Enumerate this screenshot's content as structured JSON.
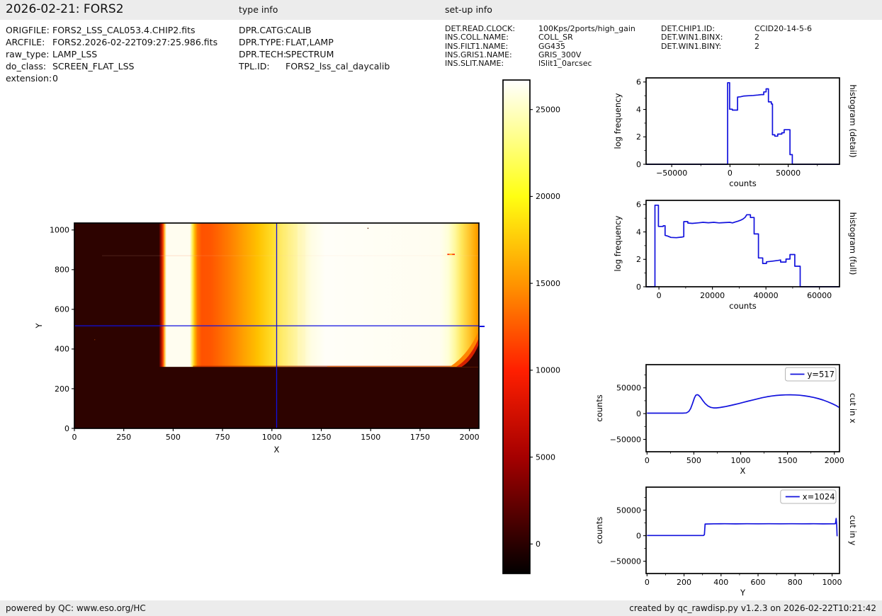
{
  "header": {
    "title": "2026-02-21: FORS2",
    "type_info_label": "type info",
    "setup_info_label": "set-up info"
  },
  "file_info": {
    "rows": [
      {
        "label": "ORIGFILE:",
        "value": "FORS2_LSS_CAL053.4.CHIP2.fits"
      },
      {
        "label": "ARCFILE:",
        "value": "FORS2.2026-02-22T09:27:25.986.fits"
      },
      {
        "label": "raw_type:",
        "value": "LAMP_LSS"
      },
      {
        "label": "do_class:",
        "value": "SCREEN_FLAT_LSS"
      },
      {
        "label": "extension:",
        "value": "0"
      }
    ]
  },
  "type_info": {
    "rows": [
      {
        "label": "DPR.CATG:",
        "value": "CALIB"
      },
      {
        "label": "DPR.TYPE:",
        "value": "FLAT,LAMP"
      },
      {
        "label": "DPR.TECH:",
        "value": "SPECTRUM"
      },
      {
        "label": "TPL.ID:",
        "value": "FORS2_lss_cal_daycalib"
      }
    ]
  },
  "setup_info": {
    "col1": [
      {
        "label": "DET.READ.CLOCK:",
        "value": "100Kps/2ports/high_gain"
      },
      {
        "label": "INS.COLL.NAME:",
        "value": "COLL_SR"
      },
      {
        "label": "INS.FILT1.NAME:",
        "value": "GG435"
      },
      {
        "label": "INS.GRIS1.NAME:",
        "value": "GRIS_300V"
      },
      {
        "label": "INS.SLIT.NAME:",
        "value": "lSlit1_0arcsec"
      }
    ],
    "col2": [
      {
        "label": "DET.CHIP1.ID:",
        "value": "CCID20-14-5-6"
      },
      {
        "label": "DET.WIN1.BINX:",
        "value": "2"
      },
      {
        "label": "DET.WIN1.BINY:",
        "value": "2"
      }
    ]
  },
  "footer": {
    "left": "powered by QC: www.eso.org/HC",
    "right": "created by qc_rawdisp.py v1.2.3 on 2026-02-22T10:21:42"
  },
  "colors": {
    "accent_blue": "#0f0fe0",
    "bar_gray": "#ececec",
    "heatmap_dark": "#2d0300"
  },
  "chart_data": [
    {
      "id": "main-image",
      "type": "heatmap",
      "xlabel": "X",
      "ylabel": "Y",
      "xlim": [
        0,
        2048
      ],
      "ylim": [
        0,
        1035
      ],
      "xticks": [
        0,
        250,
        500,
        750,
        1000,
        1250,
        1500,
        1750,
        2000
      ],
      "yticks": [
        0,
        200,
        400,
        600,
        800,
        1000
      ],
      "colormap": "hot",
      "background_color": "#2d0300",
      "crosshair": {
        "x": 1024,
        "y": 517,
        "color": "#0f0fe0"
      },
      "illuminated_region": {
        "x_range": [
          430,
          2048
        ],
        "y_range": [
          310,
          1035
        ]
      },
      "gradient_stops": [
        [
          430,
          "#4a0200"
        ],
        [
          441,
          "#b01000"
        ],
        [
          450,
          "#ff5000"
        ],
        [
          457,
          "#ffc840"
        ],
        [
          466,
          "#fffdf0"
        ],
        [
          585,
          "#fffdf0"
        ],
        [
          598,
          "#ffee55"
        ],
        [
          610,
          "#ffb400"
        ],
        [
          623,
          "#ff7200"
        ],
        [
          645,
          "#ff5200"
        ],
        [
          690,
          "#ff5600"
        ],
        [
          730,
          "#ff6600"
        ],
        [
          790,
          "#ff8000"
        ],
        [
          860,
          "#ffa200"
        ],
        [
          930,
          "#ffc200"
        ],
        [
          1000,
          "#ffdc28"
        ],
        [
          1060,
          "#ffec70"
        ],
        [
          1130,
          "#fff8b4"
        ],
        [
          1200,
          "#fffde4"
        ],
        [
          1270,
          "#fffef8"
        ],
        [
          1850,
          "#fffdf0"
        ],
        [
          1893,
          "#ffffd6"
        ],
        [
          1928,
          "#fff89c"
        ],
        [
          1962,
          "#ffe558"
        ],
        [
          2002,
          "#ffc228"
        ],
        [
          2032,
          "#ffa600"
        ],
        [
          2048,
          "#ef8e00"
        ]
      ]
    },
    {
      "id": "colorbar",
      "type": "colorbar",
      "ticks": [
        0,
        5000,
        10000,
        15000,
        20000,
        25000
      ],
      "vmin": -1700,
      "vmax": 26700,
      "stops": [
        [
          -1700,
          "#020000"
        ],
        [
          0,
          "#2a0000"
        ],
        [
          5000,
          "#a50000"
        ],
        [
          10000,
          "#ff1f00"
        ],
        [
          15000,
          "#ff9500"
        ],
        [
          20000,
          "#ffff12"
        ],
        [
          25000,
          "#ffffc3"
        ],
        [
          26700,
          "#ffffff"
        ]
      ]
    },
    {
      "id": "hist-detail",
      "type": "line",
      "right_label": "histogram (detail)",
      "xlabel": "counts",
      "ylabel": "log frequency",
      "xlim": [
        -72000,
        94000
      ],
      "ylim": [
        0,
        6.3
      ],
      "xticks": [
        -50000,
        0,
        50000
      ],
      "xticks_minor": [
        -25000,
        25000,
        75000
      ],
      "yticks": [
        0,
        2,
        4,
        6
      ],
      "yticks_minor": [
        1,
        3,
        5
      ],
      "series": [
        {
          "name": "",
          "color": "#1212dd",
          "points": [
            [
              -72000,
              0
            ],
            [
              -2000,
              0
            ],
            [
              -2000,
              5.95
            ],
            [
              -300,
              5.95
            ],
            [
              -300,
              4.02
            ],
            [
              2000,
              4.02
            ],
            [
              2000,
              3.95
            ],
            [
              6500,
              3.95
            ],
            [
              6500,
              4.9
            ],
            [
              9000,
              4.92
            ],
            [
              12000,
              4.98
            ],
            [
              16000,
              5.0
            ],
            [
              20000,
              5.02
            ],
            [
              24000,
              5.05
            ],
            [
              27000,
              5.08
            ],
            [
              29000,
              5.08
            ],
            [
              29000,
              5.28
            ],
            [
              31000,
              5.28
            ],
            [
              31000,
              5.5
            ],
            [
              33000,
              5.5
            ],
            [
              33000,
              4.55
            ],
            [
              35500,
              4.55
            ],
            [
              35500,
              4.4
            ],
            [
              36500,
              4.4
            ],
            [
              36500,
              2.15
            ],
            [
              38500,
              2.15
            ],
            [
              38500,
              2.05
            ],
            [
              41000,
              2.05
            ],
            [
              41000,
              2.2
            ],
            [
              44500,
              2.2
            ],
            [
              44500,
              2.3
            ],
            [
              46500,
              2.3
            ],
            [
              46500,
              2.52
            ],
            [
              51500,
              2.52
            ],
            [
              51500,
              0.7
            ],
            [
              53500,
              0.7
            ],
            [
              53500,
              0
            ],
            [
              94000,
              0
            ]
          ]
        }
      ]
    },
    {
      "id": "hist-full",
      "type": "line",
      "right_label": "histogram (full)",
      "xlabel": "counts",
      "ylabel": "log frequency",
      "xlim": [
        -4800,
        67500
      ],
      "ylim": [
        0,
        6.3
      ],
      "xticks": [
        0,
        20000,
        40000,
        60000
      ],
      "xticks_minor": [
        10000,
        30000,
        50000
      ],
      "yticks": [
        0,
        2,
        4,
        6
      ],
      "yticks_minor": [
        1,
        3,
        5
      ],
      "series": [
        {
          "name": "",
          "color": "#1212dd",
          "points": [
            [
              -4800,
              0
            ],
            [
              -1500,
              0
            ],
            [
              -1500,
              5.95
            ],
            [
              -200,
              5.95
            ],
            [
              -200,
              4.4
            ],
            [
              1600,
              4.4
            ],
            [
              1600,
              4.45
            ],
            [
              2300,
              4.45
            ],
            [
              2300,
              3.75
            ],
            [
              3200,
              3.7
            ],
            [
              4500,
              3.6
            ],
            [
              6500,
              3.58
            ],
            [
              8500,
              3.62
            ],
            [
              9300,
              3.65
            ],
            [
              9300,
              4.75
            ],
            [
              10800,
              4.75
            ],
            [
              10800,
              4.65
            ],
            [
              12500,
              4.62
            ],
            [
              14500,
              4.66
            ],
            [
              16500,
              4.7
            ],
            [
              18500,
              4.67
            ],
            [
              20500,
              4.7
            ],
            [
              22500,
              4.66
            ],
            [
              24500,
              4.68
            ],
            [
              26500,
              4.7
            ],
            [
              27500,
              4.66
            ],
            [
              28500,
              4.72
            ],
            [
              29500,
              4.78
            ],
            [
              30500,
              4.85
            ],
            [
              31500,
              4.95
            ],
            [
              32300,
              5.08
            ],
            [
              32800,
              5.25
            ],
            [
              34200,
              5.25
            ],
            [
              34200,
              5.05
            ],
            [
              35600,
              5.05
            ],
            [
              35600,
              3.85
            ],
            [
              37200,
              3.85
            ],
            [
              37200,
              2.1
            ],
            [
              38800,
              2.1
            ],
            [
              38800,
              1.7
            ],
            [
              40200,
              1.7
            ],
            [
              40200,
              1.82
            ],
            [
              42500,
              1.87
            ],
            [
              44500,
              1.92
            ],
            [
              45500,
              1.95
            ],
            [
              45500,
              1.8
            ],
            [
              47500,
              1.8
            ],
            [
              47500,
              2.02
            ],
            [
              49000,
              2.02
            ],
            [
              49000,
              2.35
            ],
            [
              50800,
              2.35
            ],
            [
              50800,
              1.5
            ],
            [
              52800,
              1.5
            ],
            [
              52800,
              0
            ],
            [
              67500,
              0
            ]
          ]
        }
      ]
    },
    {
      "id": "cut-x",
      "type": "line",
      "right_label": "cut in x",
      "xlabel": "X",
      "ylabel": "counts",
      "xlim": [
        -10,
        2055
      ],
      "ylim": [
        -74000,
        95000
      ],
      "xticks": [
        0,
        500,
        1000,
        1500,
        2000
      ],
      "xticks_minor": [
        250,
        750,
        1250,
        1750
      ],
      "yticks": [
        -50000,
        0,
        50000
      ],
      "yticks_minor": [
        -25000,
        25000,
        75000
      ],
      "legend": {
        "label": "y=517"
      },
      "series": [
        {
          "name": "y=517",
          "color": "#1212dd",
          "points": [
            [
              0,
              900
            ],
            [
              380,
              950
            ],
            [
              420,
              1300
            ],
            [
              445,
              4000
            ],
            [
              465,
              9500
            ],
            [
              485,
              19000
            ],
            [
              505,
              30000
            ],
            [
              520,
              35500
            ],
            [
              535,
              36800
            ],
            [
              550,
              35800
            ],
            [
              570,
              32000
            ],
            [
              595,
              25500
            ],
            [
              620,
              19500
            ],
            [
              650,
              14800
            ],
            [
              680,
              12200
            ],
            [
              710,
              11000
            ],
            [
              740,
              11100
            ],
            [
              780,
              11900
            ],
            [
              830,
              13400
            ],
            [
              880,
              15300
            ],
            [
              930,
              17400
            ],
            [
              980,
              19600
            ],
            [
              1030,
              21900
            ],
            [
              1080,
              24200
            ],
            [
              1130,
              26500
            ],
            [
              1180,
              28700
            ],
            [
              1230,
              30800
            ],
            [
              1280,
              32600
            ],
            [
              1330,
              34100
            ],
            [
              1380,
              35200
            ],
            [
              1430,
              35900
            ],
            [
              1480,
              36300
            ],
            [
              1530,
              36400
            ],
            [
              1580,
              36200
            ],
            [
              1630,
              35600
            ],
            [
              1680,
              34600
            ],
            [
              1730,
              33200
            ],
            [
              1780,
              31400
            ],
            [
              1830,
              29100
            ],
            [
              1880,
              26300
            ],
            [
              1930,
              22900
            ],
            [
              1980,
              19000
            ],
            [
              2020,
              15500
            ],
            [
              2048,
              12200
            ]
          ]
        }
      ]
    },
    {
      "id": "cut-y",
      "type": "line",
      "right_label": "cut in y",
      "xlabel": "Y",
      "ylabel": "counts",
      "xlim": [
        -5,
        1040
      ],
      "ylim": [
        -74000,
        95000
      ],
      "xticks": [
        0,
        200,
        400,
        600,
        800,
        1000
      ],
      "xticks_minor": [
        100,
        300,
        500,
        700,
        900
      ],
      "yticks": [
        -50000,
        0,
        50000
      ],
      "yticks_minor": [
        -25000,
        25000,
        75000
      ],
      "legend": {
        "label": "x=1024"
      },
      "series": [
        {
          "name": "x=1024",
          "color": "#1212dd",
          "points": [
            [
              0,
              400
            ],
            [
              150,
              420
            ],
            [
              305,
              450
            ],
            [
              310,
              2000
            ],
            [
              314,
              22800
            ],
            [
              360,
              23200
            ],
            [
              420,
              23400
            ],
            [
              480,
              23100
            ],
            [
              540,
              23400
            ],
            [
              600,
              23200
            ],
            [
              660,
              23400
            ],
            [
              720,
              23200
            ],
            [
              780,
              23400
            ],
            [
              840,
              23200
            ],
            [
              900,
              23350
            ],
            [
              950,
              23150
            ],
            [
              1000,
              23300
            ],
            [
              1012,
              23200
            ],
            [
              1018,
              23600
            ],
            [
              1022,
              33800
            ],
            [
              1025,
              20000
            ],
            [
              1027,
              0
            ],
            [
              1030,
              0
            ]
          ]
        }
      ]
    }
  ]
}
